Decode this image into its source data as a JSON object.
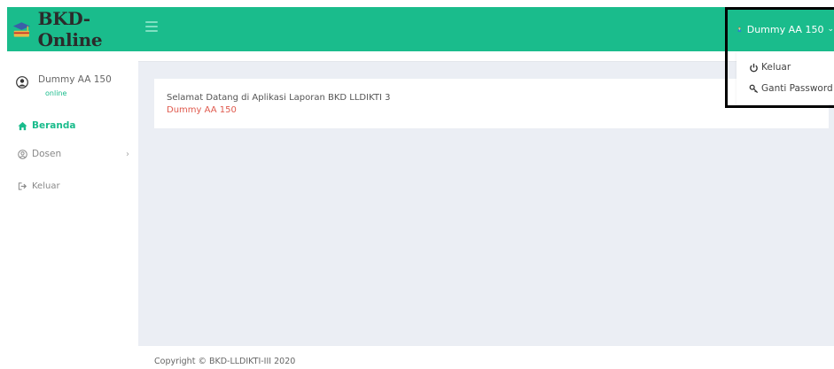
{
  "header": {
    "brand": "BKD-Online",
    "user_name": "Dummy AA 150"
  },
  "user_dropdown": {
    "items": [
      {
        "label": "Keluar",
        "icon": "power-icon"
      },
      {
        "label": "Ganti Password",
        "icon": "key-icon"
      }
    ]
  },
  "sidebar": {
    "profile": {
      "name": "Dummy AA 150",
      "status": "online"
    },
    "items": [
      {
        "label": "Beranda",
        "icon": "home-icon",
        "active": true
      },
      {
        "label": "Dosen",
        "icon": "user-circle-icon",
        "has_submenu": true
      },
      {
        "label": "Keluar",
        "icon": "sign-out-icon"
      }
    ]
  },
  "main": {
    "welcome_message": "Selamat Datang di Aplikasi Laporan BKD LLDIKTI 3",
    "welcome_user": "Dummy AA 150"
  },
  "footer": {
    "copyright": "Copyright © BKD-LLDIKTI-III 2020"
  },
  "colors": {
    "accent": "#1abc8c",
    "content_bg": "#ebeef4",
    "user_text": "#e05a4e"
  }
}
